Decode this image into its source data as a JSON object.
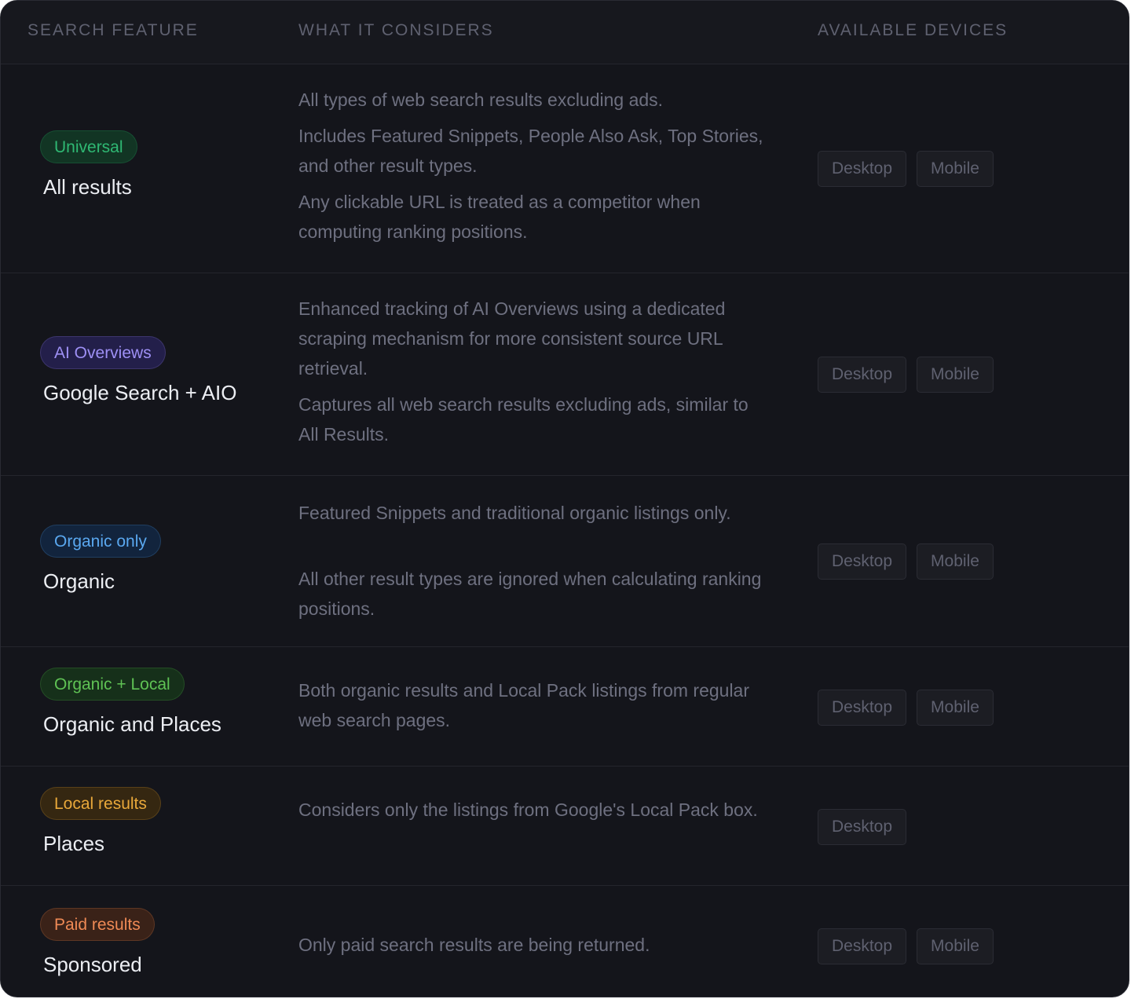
{
  "headers": {
    "feature": "SEARCH FEATURE",
    "considers": "WHAT IT CONSIDERS",
    "devices": "AVAILABLE DEVICES"
  },
  "rows": [
    {
      "badge": "Universal",
      "badge_color": "#2fb873",
      "badge_bg": "#123524",
      "name": "All results",
      "description": [
        "All types of web search results excluding ads.",
        "Includes Featured Snippets, People Also Ask, Top Stories, and other result types.",
        "Any clickable URL is treated as a competitor when computing ranking positions."
      ],
      "devices": [
        "Desktop",
        "Mobile"
      ]
    },
    {
      "badge": "AI Overviews",
      "badge_color": "#9e90f5",
      "badge_bg": "#231f4a",
      "name": "Google Search + AIO",
      "description": [
        "Enhanced tracking of AI Overviews using a dedicated scraping mechanism for more consistent source URL retrieval.",
        "Captures all web search results excluding ads, similar to All Results."
      ],
      "devices": [
        "Desktop",
        "Mobile"
      ]
    },
    {
      "badge": "Organic only",
      "badge_color": "#5aa8f0",
      "badge_bg": "#12243d",
      "name": "Organic",
      "description": [
        "Featured Snippets and traditional organic listings only.",
        "All other result types are ignored when calculating ranking positions."
      ],
      "devices": [
        "Desktop",
        "Mobile"
      ]
    },
    {
      "badge": "Organic + Local",
      "badge_color": "#5fc254",
      "badge_bg": "#16301a",
      "name": "Organic and Places",
      "description": [
        "Both organic results and Local Pack listings from regular web search pages."
      ],
      "devices": [
        "Desktop",
        "Mobile"
      ]
    },
    {
      "badge": "Local results",
      "badge_color": "#e9a83a",
      "badge_bg": "#352711",
      "name": "Places",
      "description": [
        "Considers only the listings from Google's Local Pack box."
      ],
      "devices": [
        "Desktop"
      ]
    },
    {
      "badge": "Paid results",
      "badge_color": "#ef8a55",
      "badge_bg": "#3a2218",
      "name": "Sponsored",
      "description": [
        "Only paid search results are being returned."
      ],
      "devices": [
        "Desktop",
        "Mobile"
      ]
    }
  ]
}
